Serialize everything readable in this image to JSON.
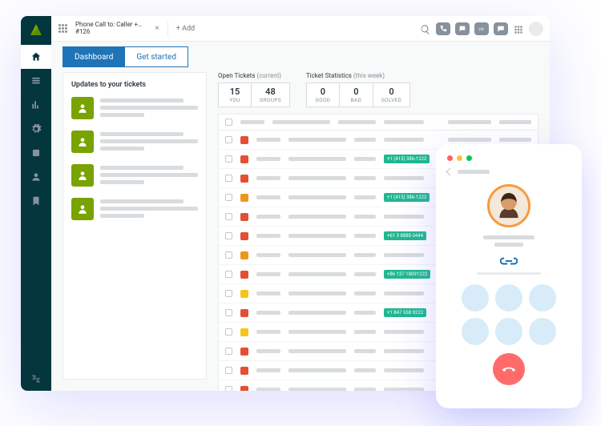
{
  "topbar": {
    "tab_title": "Phone Call to: Caller +…",
    "tab_sub": "#126",
    "add_label": "+ Add"
  },
  "subtabs": {
    "dashboard": "Dashboard",
    "get_started": "Get started"
  },
  "updates": {
    "heading": "Updates to your tickets"
  },
  "stats": {
    "open_label": "Open Tickets",
    "open_suffix": "(current)",
    "open": [
      {
        "num": "15",
        "cap": "YOU"
      },
      {
        "num": "48",
        "cap": "GROUPS"
      }
    ],
    "ticket_label": "Ticket Statistics",
    "ticket_suffix": "(this week)",
    "ticket": [
      {
        "num": "0",
        "cap": "GOOD"
      },
      {
        "num": "0",
        "cap": "BAD"
      },
      {
        "num": "0",
        "cap": "SOLVED"
      }
    ]
  },
  "rows": [
    {
      "status": "red",
      "phone": ""
    },
    {
      "status": "red",
      "phone": "+1 (415) 386-1222"
    },
    {
      "status": "red",
      "phone": ""
    },
    {
      "status": "orange",
      "phone": "+1 (415) 386-1222"
    },
    {
      "status": "red",
      "phone": ""
    },
    {
      "status": "red",
      "phone": "+61 3 8888 0444"
    },
    {
      "status": "orange",
      "phone": ""
    },
    {
      "status": "red",
      "phone": "+86 137 18091222"
    },
    {
      "status": "yellow",
      "phone": ""
    },
    {
      "status": "red",
      "phone": "+1 847 558 9222"
    },
    {
      "status": "yellow",
      "phone": ""
    },
    {
      "status": "red",
      "phone": ""
    },
    {
      "status": "red",
      "phone": ""
    },
    {
      "status": "red",
      "phone": ""
    }
  ]
}
